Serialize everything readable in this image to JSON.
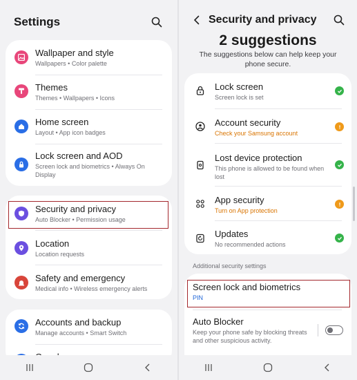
{
  "left": {
    "title": "Settings",
    "items": [
      {
        "title": "Wallpaper and style",
        "sub": "Wallpapers • Color palette",
        "color": "#e8467a"
      },
      {
        "title": "Themes",
        "sub": "Themes • Wallpapers • Icons",
        "color": "#e8467a"
      },
      {
        "title": "Home screen",
        "sub": "Layout • App icon badges",
        "color": "#2a6ee6"
      },
      {
        "title": "Lock screen and AOD",
        "sub": "Screen lock and biometrics • Always On Display",
        "color": "#2a6ee6"
      },
      {
        "title": "Security and privacy",
        "sub": "Auto Blocker • Permission usage",
        "color": "#6b4fe0"
      },
      {
        "title": "Location",
        "sub": "Location requests",
        "color": "#6b4fe0"
      },
      {
        "title": "Safety and emergency",
        "sub": "Medical info • Wireless emergency alerts",
        "color": "#d8453a"
      },
      {
        "title": "Accounts and backup",
        "sub": "Manage accounts • Smart Switch",
        "color": "#2a6ee6"
      },
      {
        "title": "Google",
        "sub": "",
        "color": "#2a6ee6"
      }
    ]
  },
  "right": {
    "title": "Security and privacy",
    "suggestions_title": "2 suggestions",
    "suggestions_sub": "The suggestions below can help keep your phone secure.",
    "items": [
      {
        "title": "Lock screen",
        "sub": "Screen lock is set",
        "status": "ok",
        "icon": "lock-icon"
      },
      {
        "title": "Account security",
        "sub": "Check your Samsung account",
        "status": "warning",
        "icon": "account-icon"
      },
      {
        "title": "Lost device protection",
        "sub": "This phone is allowed to be found when lost",
        "status": "ok",
        "icon": "device-icon"
      },
      {
        "title": "App security",
        "sub": "Turn on App protection",
        "status": "warning",
        "icon": "apps-icon"
      },
      {
        "title": "Updates",
        "sub": "No recommended actions",
        "status": "ok",
        "icon": "update-icon"
      }
    ],
    "section_label": "Additional security settings",
    "extra": [
      {
        "title": "Screen lock and biometrics",
        "sub": "PIN"
      },
      {
        "title": "Auto Blocker",
        "sub": "Keep your phone safe by blocking threats and other suspicious activity."
      }
    ]
  },
  "colors": {
    "accent_blue": "#1d65d8",
    "warning": "#d97400",
    "ok": "#35b34a",
    "highlight": "#a3262b"
  }
}
